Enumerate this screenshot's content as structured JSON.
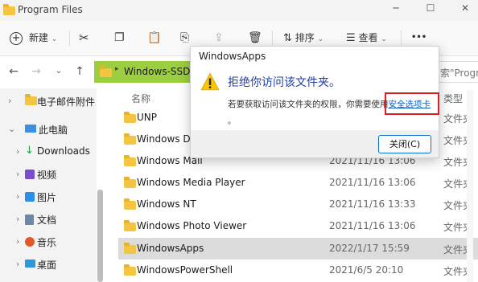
{
  "window": {
    "title": "Program Files"
  },
  "toolbar": {
    "new_label": "新建",
    "sort_label": "排序",
    "view_label": "查看",
    "more_label": "•••"
  },
  "address": {
    "path_drive": "Windows-SSD (C",
    "search_placeholder": "搜索\"Program Fil..."
  },
  "sidebar": {
    "items": [
      {
        "label": "电子邮件附件",
        "icon": "folder-icon",
        "expanded": false
      },
      {
        "label": "此电脑",
        "icon": "pc-icon",
        "expanded": true
      },
      {
        "label": "Downloads",
        "icon": "download-icon",
        "expanded": false
      },
      {
        "label": "视频",
        "icon": "video-icon",
        "expanded": false
      },
      {
        "label": "图片",
        "icon": "picture-icon",
        "expanded": false
      },
      {
        "label": "文档",
        "icon": "document-icon",
        "expanded": false
      },
      {
        "label": "音乐",
        "icon": "music-icon",
        "expanded": false
      },
      {
        "label": "桌面",
        "icon": "desktop-icon",
        "expanded": false
      }
    ]
  },
  "columns": {
    "name": "名称",
    "type": "类型"
  },
  "files": [
    {
      "name": "UNP",
      "date": "",
      "type": "文件夹"
    },
    {
      "name": "Windows Def",
      "date": "",
      "type": "文件夹"
    },
    {
      "name": "Windows Mail",
      "date": "2021/11/16 13:06",
      "type": "文件夹"
    },
    {
      "name": "Windows Media Player",
      "date": "2021/11/16 13:06",
      "type": "文件夹"
    },
    {
      "name": "Windows NT",
      "date": "2021/11/16 13:33",
      "type": "文件夹"
    },
    {
      "name": "Windows Photo Viewer",
      "date": "2021/11/16 13:06",
      "type": "文件夹"
    },
    {
      "name": "WindowsApps",
      "date": "2022/1/17 15:59",
      "type": "文件夹",
      "selected": true
    },
    {
      "name": "WindowsPowerShell",
      "date": "2021/6/5 20:10",
      "type": "文件夹"
    }
  ],
  "dialog": {
    "title": "WindowsApps",
    "heading": "拒绝你访问该文件夹。",
    "message": "若要获取访问该文件夹的权限，你需要使用",
    "link": "安全选项卡",
    "trailing": "。",
    "close_label": "关闭(C)"
  },
  "colors": {
    "accent": "#0b5fc4",
    "highlight_box": "#d81f26",
    "address_bg": "#9ccf3f",
    "folder": "#f4c542"
  }
}
